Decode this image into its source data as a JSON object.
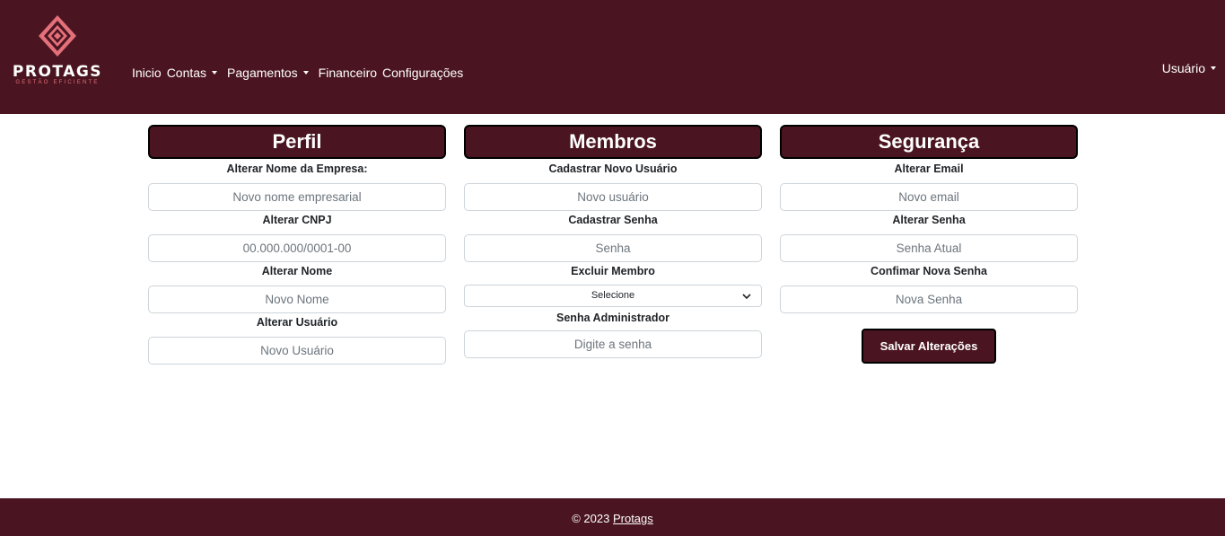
{
  "brand": {
    "name": "PROTAGS",
    "tagline": "GESTÃO EFICIENTE",
    "accent": "#e3707a",
    "primary": "#4a1520"
  },
  "nav": {
    "items": [
      {
        "label": "Inicio",
        "dropdown": false
      },
      {
        "label": "Contas",
        "dropdown": true
      },
      {
        "label": "Pagamentos",
        "dropdown": true
      },
      {
        "label": "Financeiro",
        "dropdown": false
      },
      {
        "label": "Configurações",
        "dropdown": false
      }
    ],
    "user": "Usuário"
  },
  "perfil": {
    "title": "Perfil",
    "company_label": "Alterar Nome da Empresa:",
    "company_placeholder": "Novo nome empresarial",
    "cnpj_label": "Alterar CNPJ",
    "cnpj_placeholder": "00.000.000/0001-00",
    "name_label": "Alterar Nome",
    "name_placeholder": "Novo Nome",
    "user_label": "Alterar Usuário",
    "user_placeholder": "Novo Usuário"
  },
  "membros": {
    "title": "Membros",
    "new_user_label": "Cadastrar Novo Usuário",
    "new_user_placeholder": "Novo usuário",
    "password_label": "Cadastrar Senha",
    "password_placeholder": "Senha",
    "remove_label": "Excluir Membro",
    "remove_selected": "Selecione",
    "admin_label": "Senha Administrador",
    "admin_placeholder": "Digite a senha"
  },
  "seguranca": {
    "title": "Segurança",
    "email_label": "Alterar Email",
    "email_placeholder": "Novo email",
    "password_label": "Alterar Senha",
    "password_placeholder": "Senha Atual",
    "confirm_label": "Confimar Nova Senha",
    "confirm_placeholder": "Nova Senha",
    "save_label": "Salvar Alterações"
  },
  "footer": {
    "copyright": "© 2023",
    "link": "Protags"
  }
}
